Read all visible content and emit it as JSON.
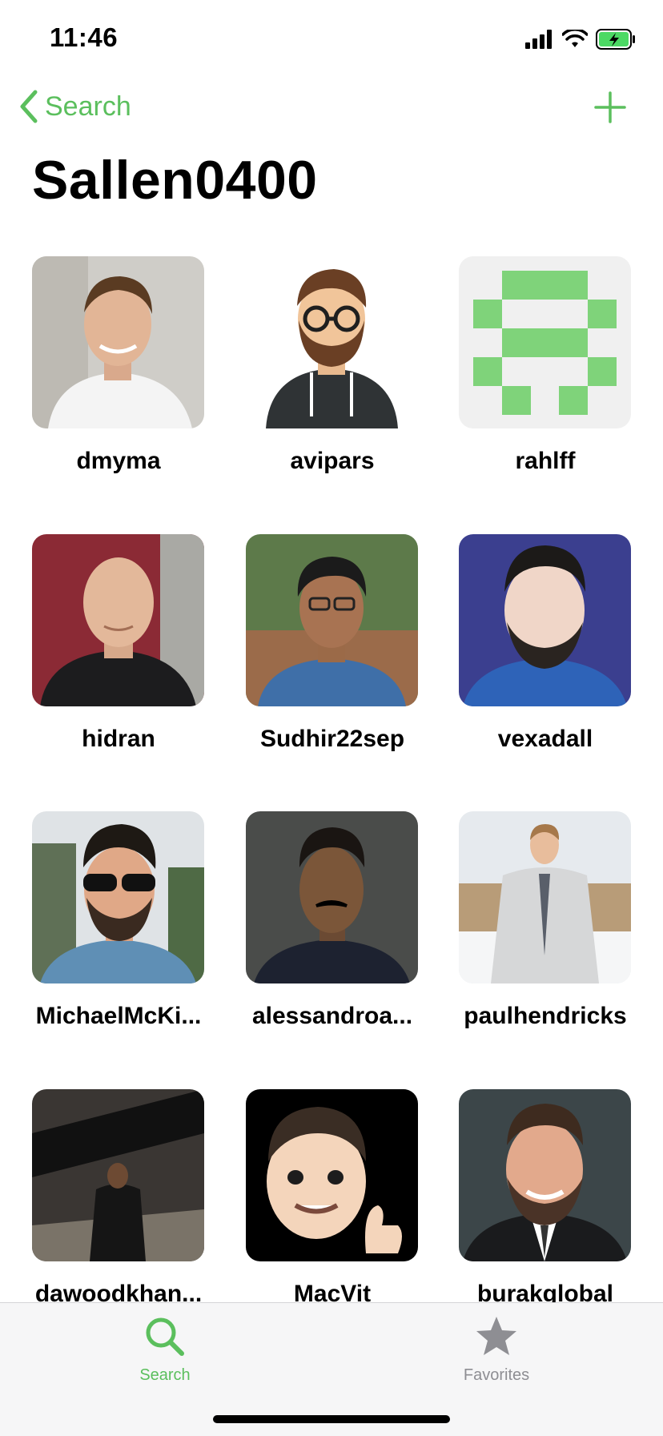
{
  "status": {
    "time": "11:46"
  },
  "nav": {
    "back_label": "Search"
  },
  "page": {
    "title": "Sallen0400"
  },
  "users": [
    {
      "username": "dmyma"
    },
    {
      "username": "avipars"
    },
    {
      "username": "rahlff"
    },
    {
      "username": "hidran"
    },
    {
      "username": "Sudhir22sep"
    },
    {
      "username": "vexadall"
    },
    {
      "username": "MichaelMcKi..."
    },
    {
      "username": "alessandroa..."
    },
    {
      "username": "paulhendricks"
    },
    {
      "username": "dawoodkhan..."
    },
    {
      "username": "MacVit"
    },
    {
      "username": "burakglobal"
    }
  ],
  "tabs": {
    "search_label": "Search",
    "favorites_label": "Favorites"
  },
  "colors": {
    "accent": "#5bbf5d",
    "inactive": "#8e8e93"
  }
}
